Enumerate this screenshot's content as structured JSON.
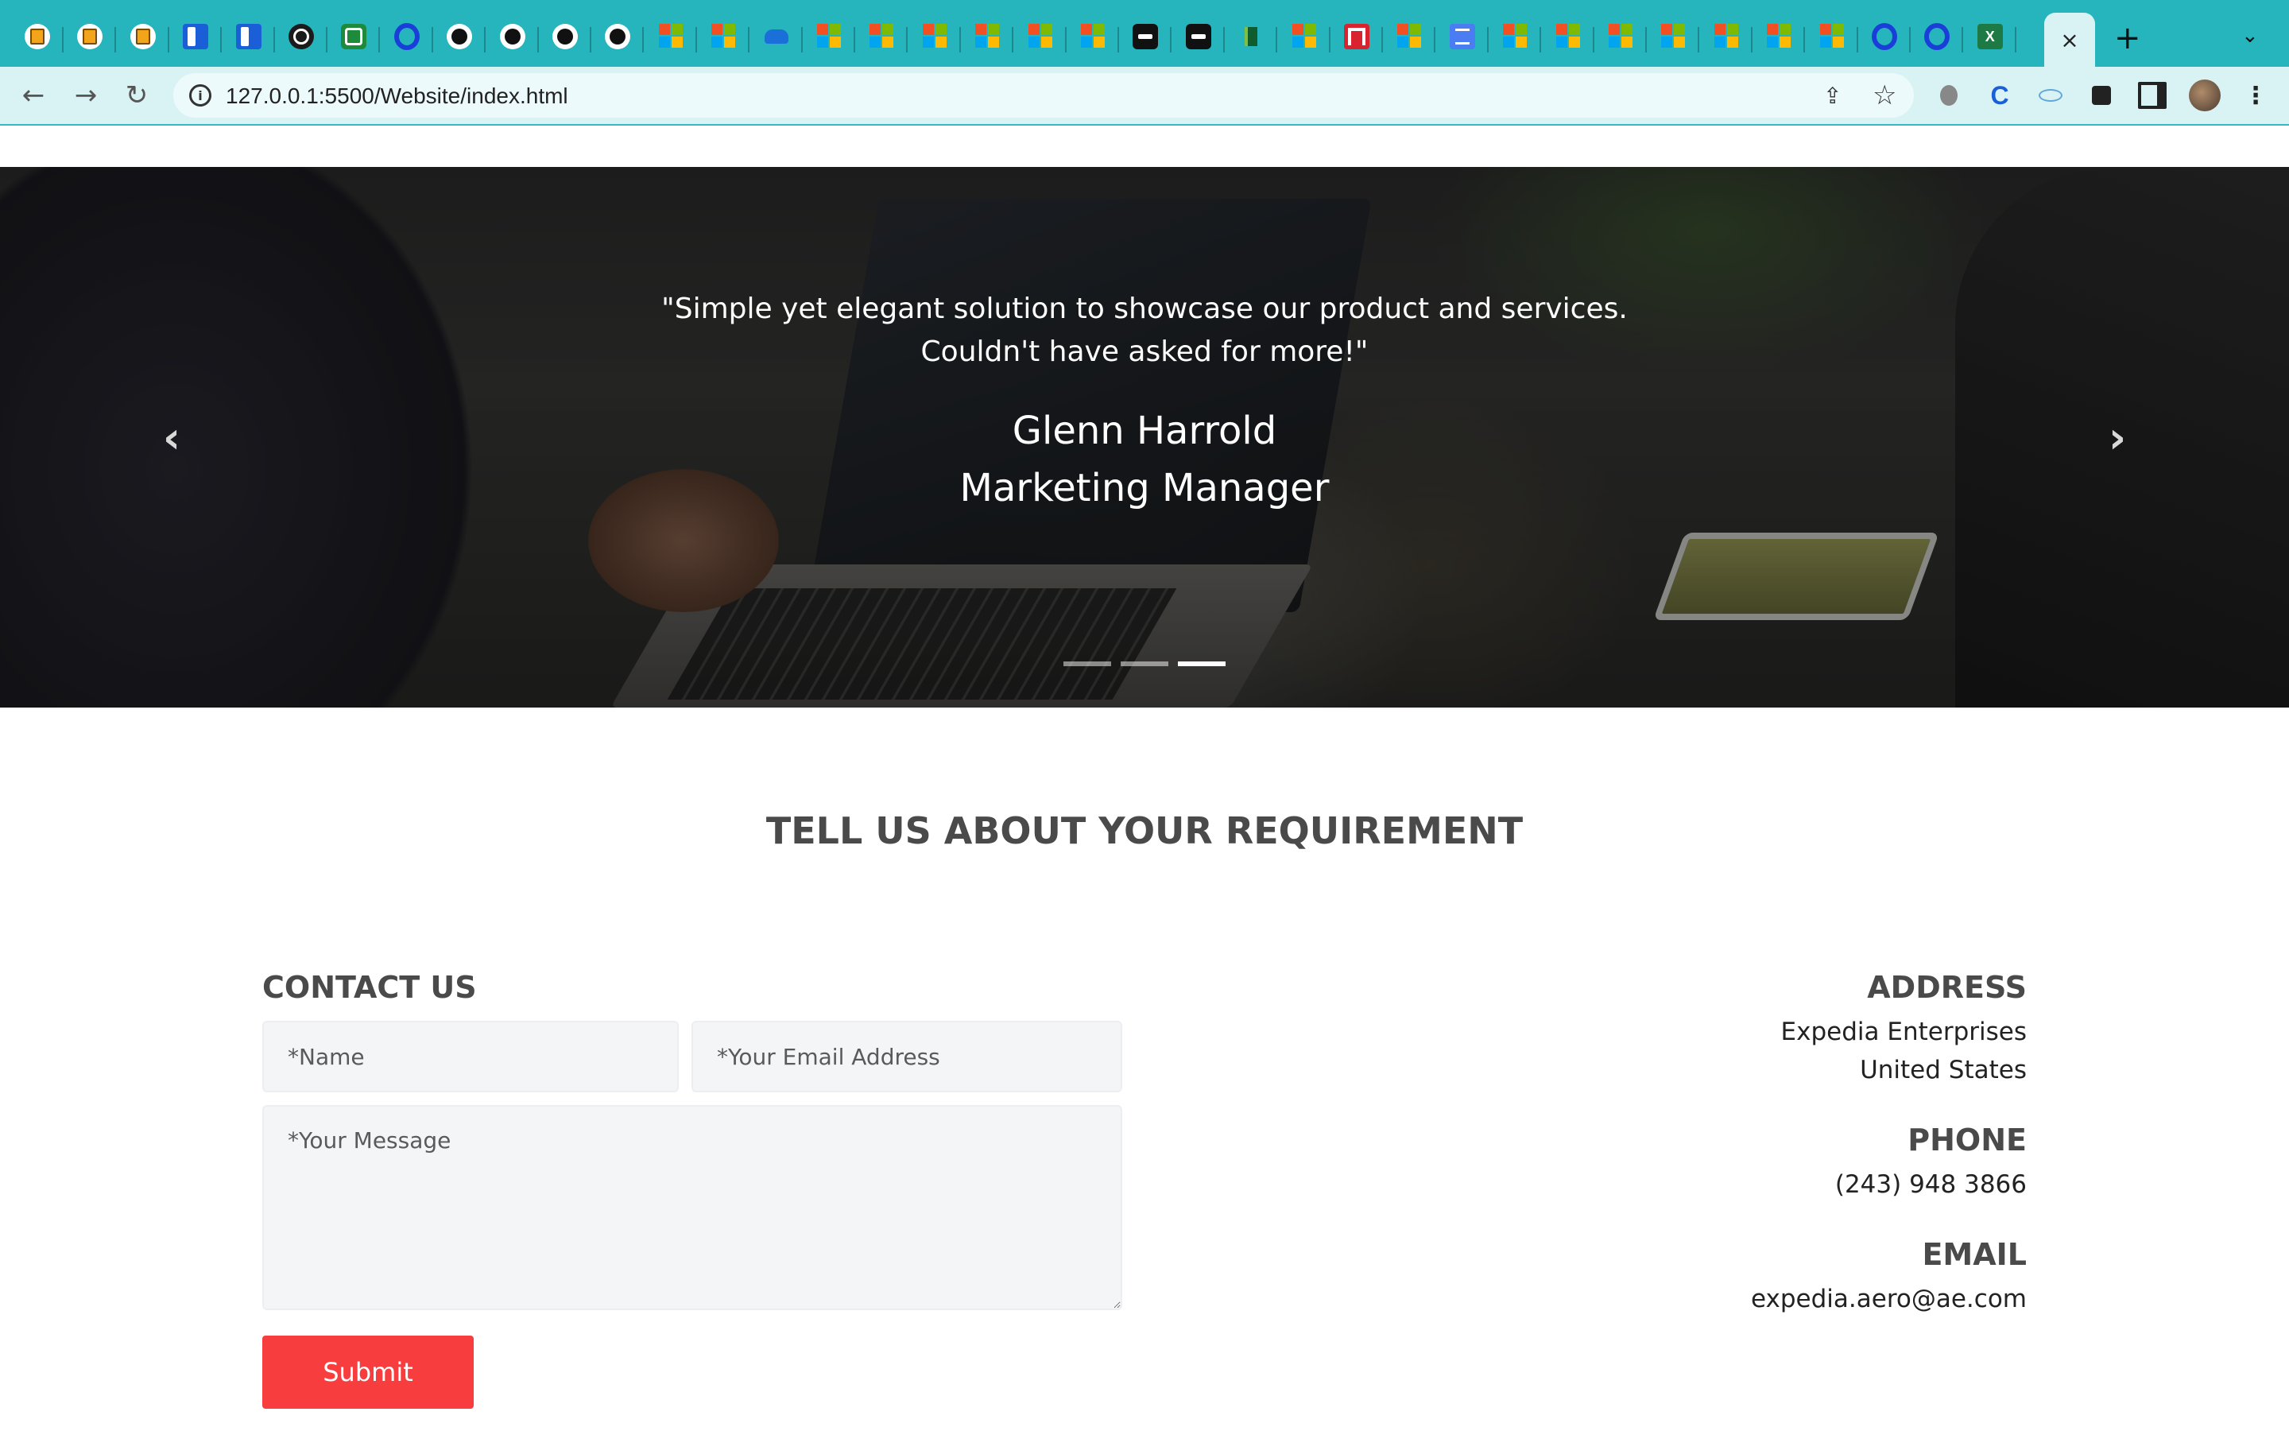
{
  "browser": {
    "tabs": [
      {
        "icon": "beer-icon"
      },
      {
        "icon": "beer-icon"
      },
      {
        "icon": "beer-icon"
      },
      {
        "icon": "pane-icon"
      },
      {
        "icon": "pane-icon"
      },
      {
        "icon": "octopus-icon"
      },
      {
        "icon": "green-app-icon"
      },
      {
        "icon": "blue-p-icon"
      },
      {
        "icon": "github-icon"
      },
      {
        "icon": "github-icon"
      },
      {
        "icon": "github-icon"
      },
      {
        "icon": "github-icon"
      },
      {
        "icon": "microsoft-icon"
      },
      {
        "icon": "microsoft-icon"
      },
      {
        "icon": "onedrive-icon"
      },
      {
        "icon": "microsoft-icon"
      },
      {
        "icon": "microsoft-icon"
      },
      {
        "icon": "microsoft-icon"
      },
      {
        "icon": "microsoft-icon"
      },
      {
        "icon": "microsoft-icon"
      },
      {
        "icon": "microsoft-icon"
      },
      {
        "icon": "black-app-icon"
      },
      {
        "icon": "black-app-icon"
      },
      {
        "icon": "flag-icon"
      },
      {
        "icon": "microsoft-icon"
      },
      {
        "icon": "red-app-icon"
      },
      {
        "icon": "microsoft-icon"
      },
      {
        "icon": "docs-icon"
      },
      {
        "icon": "microsoft-icon"
      },
      {
        "icon": "microsoft-icon"
      },
      {
        "icon": "microsoft-icon"
      },
      {
        "icon": "microsoft-icon"
      },
      {
        "icon": "microsoft-icon"
      },
      {
        "icon": "microsoft-icon"
      },
      {
        "icon": "microsoft-icon"
      },
      {
        "icon": "blue-p-icon"
      },
      {
        "icon": "blue-p-icon"
      },
      {
        "icon": "excel-icon"
      }
    ],
    "active_tab_close": "×",
    "new_tab": "+",
    "tab_menu": "⌄",
    "url": "127.0.0.1:5500/Website/index.html",
    "info_glyph": "i",
    "colors": {
      "tabstrip": "#26b5bd",
      "toolbar": "#d9f3f4"
    }
  },
  "hero": {
    "quote_line1": "\"Simple yet elegant solution to showcase our product and services.",
    "quote_line2": "Couldn't have asked for more!\"",
    "name": "Glenn Harrold",
    "role": "Marketing Manager",
    "prev_arrow": "‹",
    "next_arrow": "›",
    "slides": 3,
    "active_slide": 3
  },
  "section": {
    "title": "TELL US ABOUT YOUR REQUIREMENT"
  },
  "contact": {
    "heading": "CONTACT US",
    "name_placeholder": "*Name",
    "email_placeholder": "*Your Email Address",
    "message_placeholder": "*Your Message",
    "submit_label": "Submit",
    "submit_color": "#f73d3d"
  },
  "info": {
    "address_heading": "ADDRESS",
    "address_line1": "Expedia Enterprises",
    "address_line2": "United States",
    "phone_heading": "PHONE",
    "phone": "(243) 948 3866",
    "email_heading": "EMAIL",
    "email": "expedia.aero@ae.com"
  }
}
